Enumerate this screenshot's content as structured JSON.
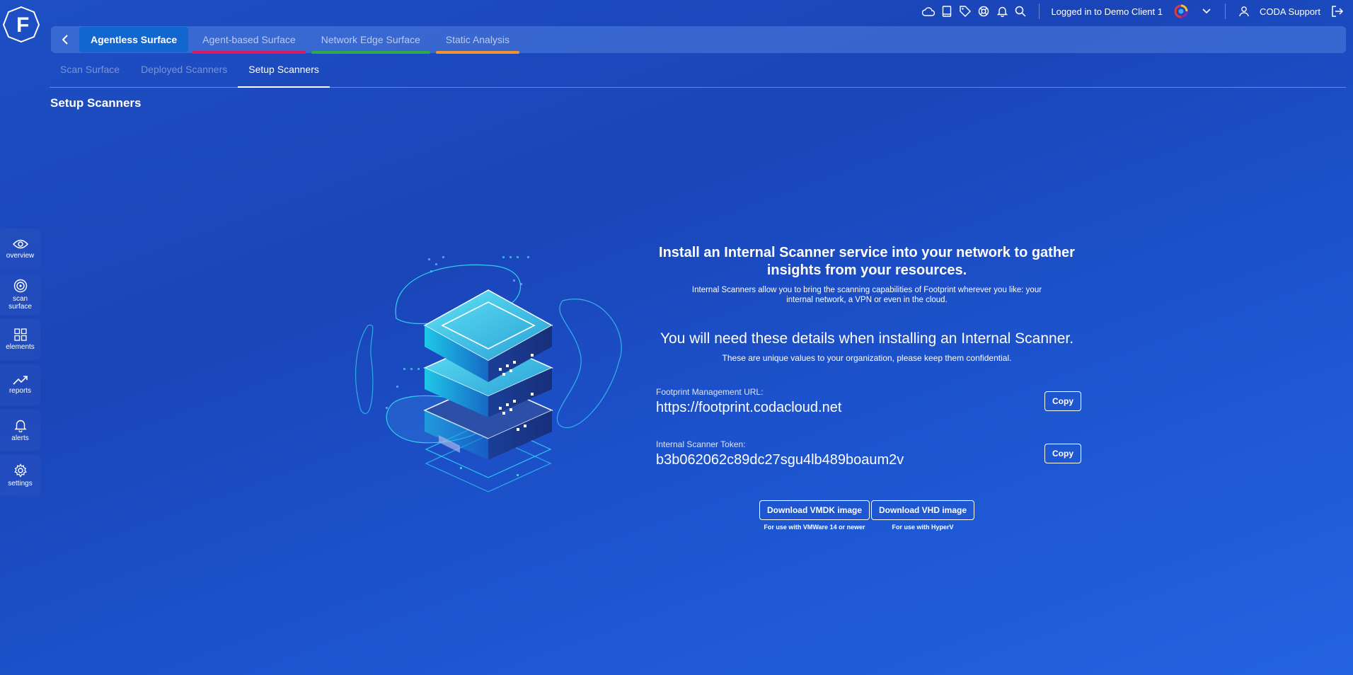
{
  "logo": {
    "letter": "F"
  },
  "topbar": {
    "icons": [
      "cloud-icon",
      "book-icon",
      "tag-icon",
      "lifebuoy-icon",
      "bell-icon",
      "search-icon"
    ],
    "login_text": "Logged in to Demo Client 1",
    "user_name": "CODA Support"
  },
  "surface_tabs": [
    {
      "label": "Agentless Surface",
      "active": true,
      "color": ""
    },
    {
      "label": "Agent-based Surface",
      "active": false,
      "color": "#d81b60"
    },
    {
      "label": "Network Edge Surface",
      "active": false,
      "color": "#2eaa48"
    },
    {
      "label": "Static Analysis",
      "active": false,
      "color": "#f5922a"
    }
  ],
  "sub_tabs": [
    {
      "label": "Scan Surface",
      "active": false
    },
    {
      "label": "Deployed Scanners",
      "active": false
    },
    {
      "label": "Setup Scanners",
      "active": true
    }
  ],
  "page_title": "Setup Scanners",
  "left_nav": [
    {
      "label": "overview",
      "icon": "eye-icon"
    },
    {
      "label": "scan surface",
      "icon": "target-icon"
    },
    {
      "label": "elements",
      "icon": "grid-icon"
    },
    {
      "label": "reports",
      "icon": "trend-icon"
    },
    {
      "label": "alerts",
      "icon": "bell-icon"
    },
    {
      "label": "settings",
      "icon": "gear-icon"
    }
  ],
  "content": {
    "headline": "Install an Internal Scanner service into your network to gather insights from your resources.",
    "subtext": "Internal Scanners allow you to bring the scanning capabilities of Footprint wherever you like: your internal network, a VPN or even in the cloud.",
    "headline2": "You will need these details when installing an Internal Scanner.",
    "subtext2": "These are unique values to your organization, please keep them confidential.",
    "url_label": "Footprint Management URL:",
    "url_value": "https://footprint.codacloud.net",
    "token_label": "Internal Scanner Token:",
    "token_value": "b3b062062c89dc27sgu4lb489boaum2v",
    "copy_label": "Copy",
    "vmdk_label": "Download VMDK image",
    "vmdk_note": "For use with VMWare 14 or newer",
    "vhd_label": "Download VHD image",
    "vhd_note": "For use with HyperV"
  },
  "colors": {
    "accent_active_tab": "#1266cf",
    "agent_based": "#d81b60",
    "network_edge": "#2eaa48",
    "static_analysis": "#f5922a"
  }
}
